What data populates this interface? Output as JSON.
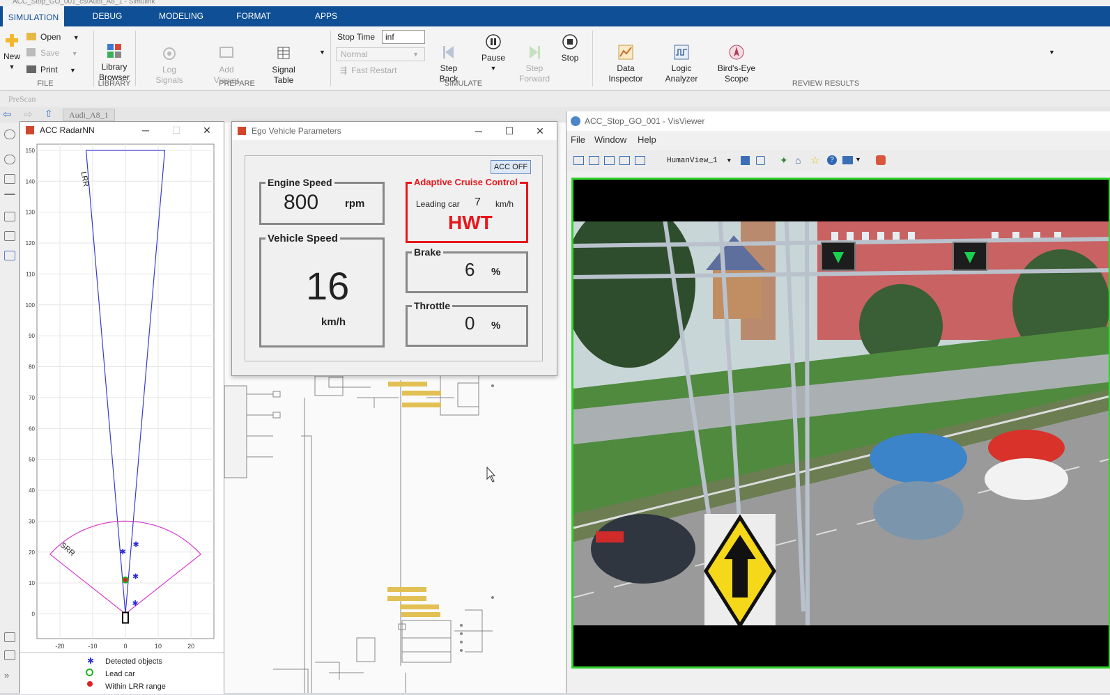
{
  "window": {
    "title": "ACC_Stop_GO_001_cs/Audi_A8_1 - Simulink"
  },
  "tabs": [
    {
      "label": "SIMULATION",
      "active": true
    },
    {
      "label": "DEBUG"
    },
    {
      "label": "MODELING"
    },
    {
      "label": "FORMAT"
    },
    {
      "label": "APPS"
    }
  ],
  "ribbon": {
    "file": {
      "new": "New",
      "open": "Open",
      "save": "Save",
      "print": "Print",
      "group": "FILE"
    },
    "library": {
      "browser": "Library\nBrowser",
      "group": "LIBRARY"
    },
    "prepare": {
      "log_signals": "Log\nSignals",
      "add_viewer": "Add\nViewer",
      "signal_table": "Signal\nTable",
      "group": "PREPARE"
    },
    "simulate": {
      "stop_time_label": "Stop Time",
      "stop_time_value": "inf",
      "mode": "Normal",
      "fast_restart": "Fast Restart",
      "step_back": "Step\nBack",
      "pause": "Pause",
      "step_forward": "Step\nForward",
      "stop": "Stop",
      "group": "SIMULATE"
    },
    "review": {
      "data_inspector": "Data\nInspector",
      "logic_analyzer": "Logic\nAnalyzer",
      "birds_eye": "Bird's-Eye\nScope",
      "group": "REVIEW RESULTS"
    }
  },
  "prescan_bar": "PreScan",
  "breadcrumb": "Audi_A8_1",
  "radar": {
    "title": "ACC RadarNN",
    "legend": [
      "Detected objects",
      "Lead car",
      "Within LRR range"
    ],
    "lrr_label": "LRR",
    "srr_label": "SRR"
  },
  "chart_data": {
    "type": "scatter",
    "title": "",
    "xlabel": "",
    "ylabel": "",
    "xlim": [
      -27,
      27
    ],
    "ylim": [
      -8,
      152
    ],
    "x_ticks": [
      -20,
      -10,
      0,
      10,
      20
    ],
    "y_ticks": [
      0,
      10,
      20,
      30,
      40,
      50,
      60,
      70,
      80,
      90,
      100,
      110,
      120,
      130,
      140,
      150
    ],
    "grid": true,
    "series": [
      {
        "name": "Detected objects",
        "color": "#2a2ad8",
        "points": [
          [
            -0.8,
            20.2
          ],
          [
            3.2,
            22.5
          ],
          [
            3.1,
            12.2
          ],
          [
            3.0,
            3.5
          ]
        ]
      },
      {
        "name": "Lead car",
        "color": "#22b022",
        "points": [
          [
            0.0,
            11.0
          ]
        ]
      }
    ],
    "lrr_sector": {
      "range": 150,
      "half_width_at_range": 12
    },
    "srr_sector": {
      "range": 30,
      "half_angle_deg": 50
    },
    "ego_marker": [
      0,
      0
    ]
  },
  "ego": {
    "title": "Ego Vehicle Parameters",
    "acc_button": "ACC OFF",
    "engine_label": "Engine Speed",
    "engine_value": "800",
    "engine_unit": "rpm",
    "vehicle_label": "Vehicle Speed",
    "vehicle_value": "16",
    "vehicle_unit": "km/h",
    "acc_label": "Adaptive Cruise Control",
    "leading_label": "Leading car",
    "leading_value": "7",
    "leading_unit": "km/h",
    "acc_mode": "HWT",
    "brake_label": "Brake",
    "brake_value": "6",
    "brake_unit": "%",
    "throttle_label": "Throttle",
    "throttle_value": "0",
    "throttle_unit": "%"
  },
  "visviewer": {
    "title": "ACC_Stop_GO_001 - VisViewer",
    "menu": [
      "File",
      "Window",
      "Help"
    ],
    "view": "HumanView_1"
  },
  "colors": {
    "ribbon_blue": "#0e4f95",
    "acc_red": "#e8161b",
    "scene_border": "#2fd42b"
  }
}
